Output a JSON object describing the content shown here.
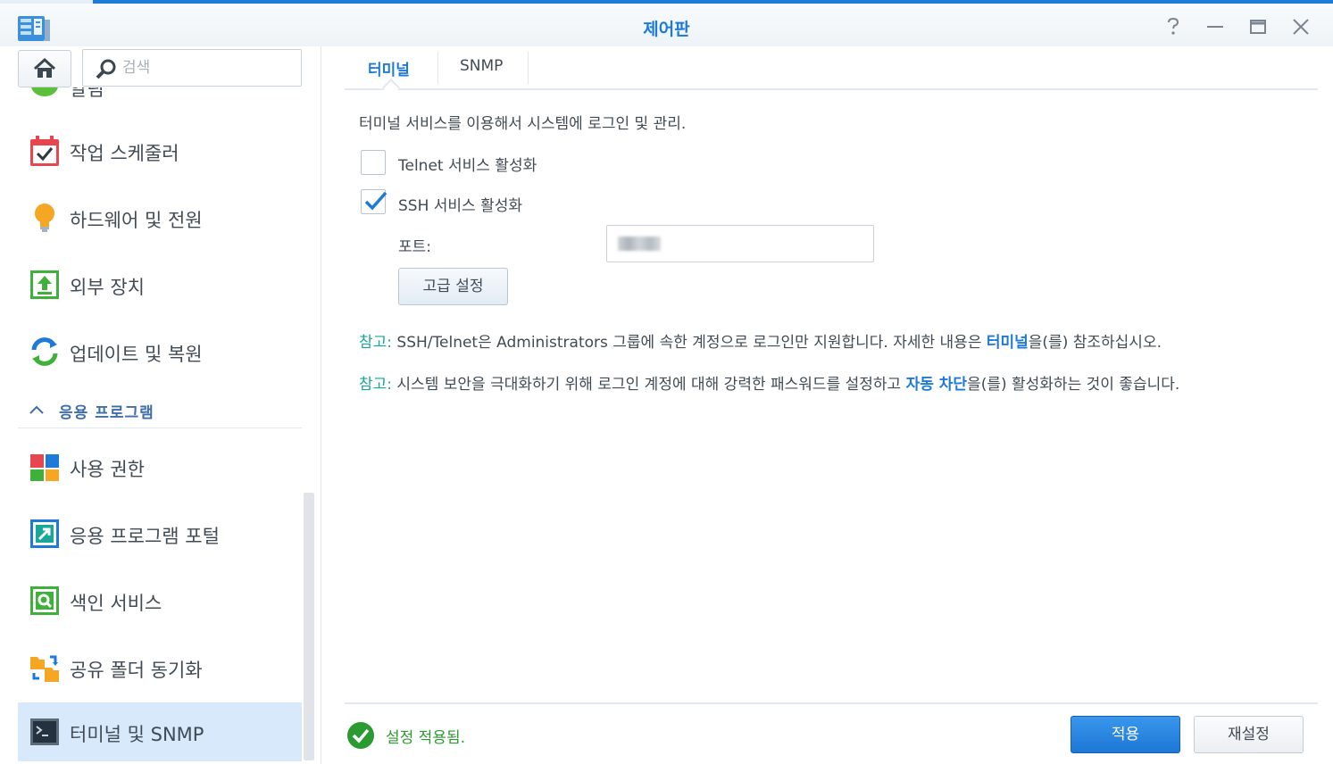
{
  "window": {
    "title": "제어판",
    "controls": [
      "help-icon",
      "minimize-icon",
      "maximize-icon",
      "close-icon"
    ]
  },
  "sidebar": {
    "search_placeholder": "검색",
    "partial_item": "알림",
    "items": [
      {
        "label": "작업 스케줄러",
        "icon": "task-scheduler-icon",
        "color": "#e8454e"
      },
      {
        "label": "하드웨어 및 전원",
        "icon": "lightbulb-icon",
        "color": "#f5a623"
      },
      {
        "label": "외부 장치",
        "icon": "external-device-icon",
        "color": "#3fb03a"
      },
      {
        "label": "업데이트 및 복원",
        "icon": "update-restore-icon",
        "color": "#1e7ad8"
      }
    ],
    "section": {
      "label": "응용 프로그램"
    },
    "app_items": [
      {
        "label": "사용 권한",
        "icon": "privileges-icon"
      },
      {
        "label": "응용 프로그램 포털",
        "icon": "app-portal-icon"
      },
      {
        "label": "색인 서비스",
        "icon": "indexing-service-icon"
      },
      {
        "label": "공유 폴더 동기화",
        "icon": "shared-folder-sync-icon"
      },
      {
        "label": "터미널 및 SNMP",
        "icon": "terminal-icon",
        "active": true
      }
    ]
  },
  "tabs": [
    {
      "label": "터미널",
      "active": true
    },
    {
      "label": "SNMP",
      "active": false
    }
  ],
  "terminal": {
    "description": "터미널 서비스를 이용해서 시스템에 로그인 및 관리.",
    "telnet": {
      "label": "Telnet 서비스 활성화",
      "checked": false
    },
    "ssh": {
      "label": "SSH 서비스 활성화",
      "checked": true
    },
    "port_label": "포트:",
    "advanced_button": "고급 설정",
    "note1": {
      "tag": "참고:",
      "text_before": " SSH/Telnet은 Administrators 그룹에 속한 계정으로 로그인만 지원합니다. 자세한 내용은 ",
      "link": "터미널",
      "text_after": "을(를) 참조하십시오."
    },
    "note2": {
      "tag": "참고:",
      "text_before": " 시스템 보안을 극대화하기 위해 로그인 계정에 대해 강력한 패스워드를 설정하고 ",
      "link": "자동 차단",
      "text_after": "을(를) 활성화하는 것이 좋습니다."
    }
  },
  "footer": {
    "status": "설정 적용됨.",
    "apply": "적용",
    "reset": "재설정"
  },
  "colors": {
    "accent": "#1e7ad8",
    "note_tag": "#1aa698",
    "success": "#2b9a31"
  }
}
